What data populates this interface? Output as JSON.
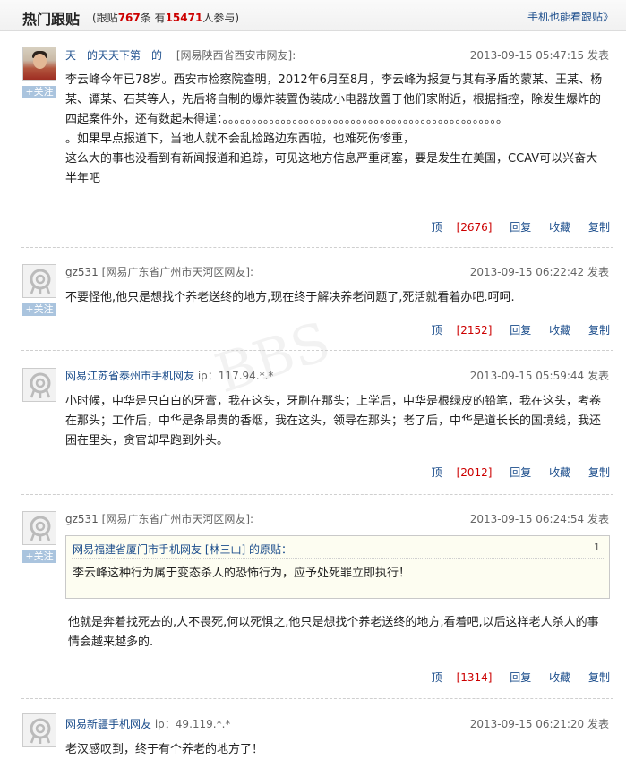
{
  "header": {
    "title": "热门跟贴",
    "stats_prefix": "(跟贴",
    "replies_count": "767",
    "stats_mid": "条 有",
    "participants_count": "15471",
    "stats_suffix": "人参与)",
    "mobile_link": "手机也能看跟贴》"
  },
  "follow_label": "+关注",
  "watermark": "BBS",
  "posts": [
    {
      "username": "天一的天天下第一的一",
      "location": "[网易陕西省西安市网友]:",
      "time": "2013-09-15 05:47:15 发表",
      "content": [
        "李云峰今年已78岁。西安市检察院查明，2012年6月至8月，李云峰为报复与其有矛盾的蒙某、王某、杨某、谭某、石某等人，先后将自制的爆炸装置伪装成小电器放置于他们家附近，根据指控，除发生爆炸的四起案件外，还有数起未得逞：。。。。。。。。。。。。。。。。。。。。。。。。。。。。。。。。。。。。。。。。。。。。。。。。",
        "。如果早点报道下，当地人就不会乱捡路边东西啦，也难死伤惨重，",
        "这么大的事也没看到有新闻报道和追踪，可见这地方信息严重闭塞，要是发生在美国，CCAV可以兴奋大半年吧"
      ],
      "up_label": "顶",
      "up_count": "[2676]",
      "reply": "回复",
      "favorite": "收藏",
      "copy": "复制"
    },
    {
      "username": "gz531",
      "location": "[网易广东省广州市天河区网友]:",
      "time": "2013-09-15 06:22:42 发表",
      "content": [
        "不要怪他,他只是想找个养老送终的地方,现在终于解决养老问题了,死活就看着办吧.呵呵."
      ],
      "up_label": "顶",
      "up_count": "[2152]",
      "reply": "回复",
      "favorite": "收藏",
      "copy": "复制"
    },
    {
      "username": "网易江苏省泰州市手机网友",
      "location": "ip：117.94.*.*",
      "time": "2013-09-15 05:59:44 发表",
      "content": [
        "小时候，中华是只白白的牙膏，我在这头，牙刷在那头；上学后，中华是根绿皮的铅笔，我在这头，考卷在那头；工作后，中华是条昂贵的香烟，我在这头，领导在那头；老了后，中华是道长长的国境线，我还困在里头，贪官却早跑到外头。"
      ],
      "up_label": "顶",
      "up_count": "[2012]",
      "reply": "回复",
      "favorite": "收藏",
      "copy": "复制"
    },
    {
      "username": "gz531",
      "location": "[网易广东省广州市天河区网友]:",
      "time": "2013-09-15 06:24:54 发表",
      "quote": {
        "header": "网易福建省厦门市手机网友 [林三山] 的原贴：",
        "number": "1",
        "text": "李云峰这种行为属于变态杀人的恐怖行为，应予处死罪立即执行！"
      },
      "content": [
        "他就是奔着找死去的,人不畏死,何以死惧之,他只是想找个养老送终的地方,看着吧,以后这样老人杀人的事情会越来越多的."
      ],
      "up_label": "顶",
      "up_count": "[1314]",
      "reply": "回复",
      "favorite": "收藏",
      "copy": "复制"
    },
    {
      "username": "网易新疆手机网友",
      "location": "ip：49.119.*.*",
      "time": "2013-09-15 06:21:20 发表",
      "content": [
        "老汉感叹到，终于有个养老的地方了！"
      ]
    }
  ],
  "colors": {
    "link": "#1a4c8b",
    "count_red": "#c00000",
    "follow_button": "#aac4de",
    "quote_bg": "#fdfdf1"
  }
}
